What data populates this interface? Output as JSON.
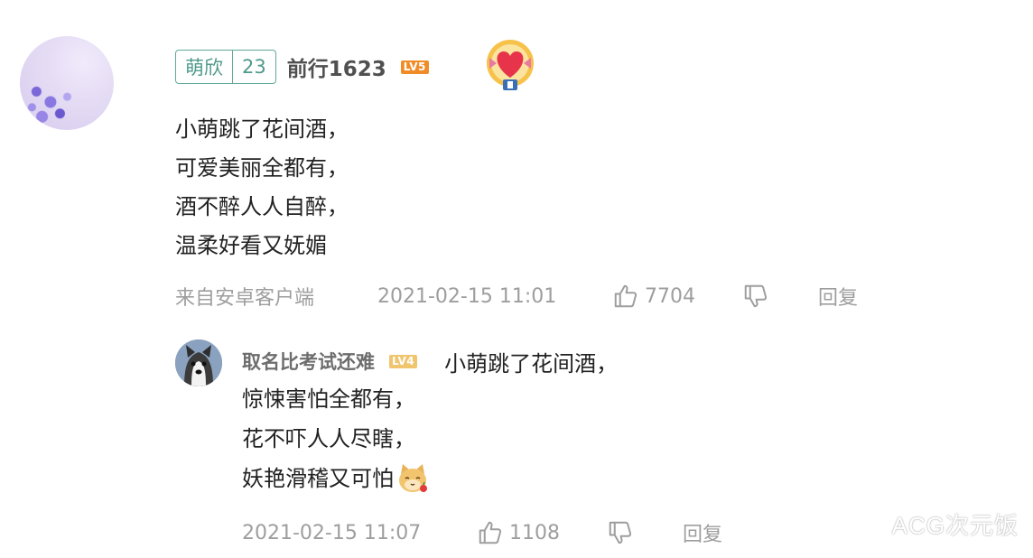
{
  "comment": {
    "fan_badge": {
      "name": "萌欣",
      "level": "23"
    },
    "username": "前行1623",
    "level_badge": "LV5",
    "lines": [
      "小萌跳了花间酒，",
      "可爱美丽全都有，",
      "酒不醉人人自醉，",
      "温柔好看又妩媚"
    ],
    "source": "来自安卓客户端",
    "time": "2021-02-15 11:01",
    "likes": "7704",
    "reply_label": "回复"
  },
  "reply": {
    "username": "取名比考试还难",
    "level_badge": "LV4",
    "first_line": "小萌跳了花间酒，",
    "lines": [
      "惊悚害怕全都有，",
      "花不吓人人尽瞎，",
      "妖艳滑稽又可怕"
    ],
    "emoji": "cat-emoji-icon",
    "time": "2021-02-15 11:07",
    "likes": "1108",
    "reply_label": "回复"
  },
  "watermark": "ACG次元饭",
  "colors": {
    "fan_badge": "#5fa99a",
    "lv5": "#f08c27",
    "lv4": "#f0c56e",
    "meta_text": "#9e9e9e"
  }
}
